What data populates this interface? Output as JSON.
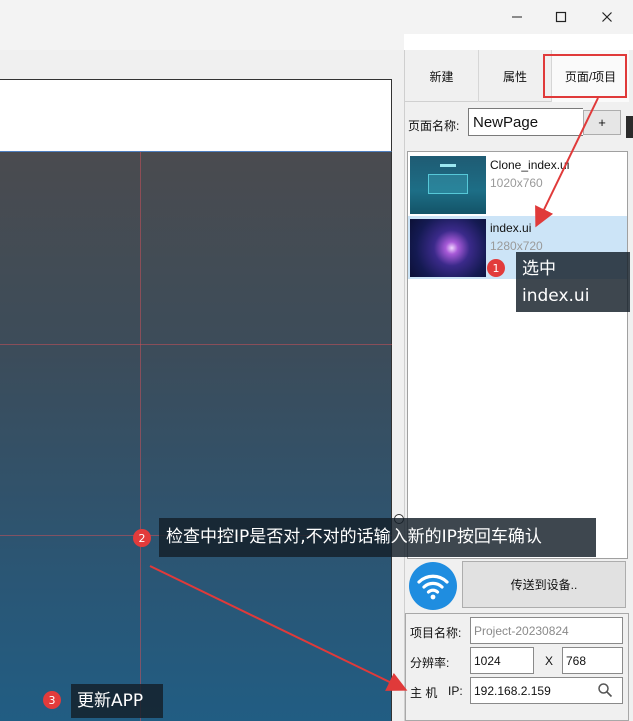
{
  "window": {
    "controls": {
      "minimize_icon": "minimize-icon",
      "maximize_icon": "maximize-icon",
      "close_icon": "close-icon"
    }
  },
  "panel": {
    "tabs": [
      {
        "label": "新建"
      },
      {
        "label": "属性"
      },
      {
        "label": "页面/项目"
      }
    ],
    "page_name": {
      "label": "页面名称:",
      "value": "NewPage",
      "add_label": "+"
    },
    "pages": [
      {
        "name": "Clone_index.ui",
        "size": "1020x760"
      },
      {
        "name": "index.ui",
        "size": "1280x720",
        "selected": true
      }
    ],
    "send_label": "传送到设备..",
    "project": {
      "name_label": "项目名称:",
      "name_placeholder": "Project-20230824",
      "resolution_label": "分辨率:",
      "width": "1024",
      "x_label": "X",
      "height": "768",
      "host_label": "主 机",
      "ip_label": "IP:",
      "ip_value": "192.168.2.159"
    }
  },
  "annotations": [
    {
      "num": "1",
      "line1": "选中",
      "line2": "index.ui"
    },
    {
      "num": "2",
      "text": "检查中控IP是否对,不对的话输入新的IP按回车确认"
    },
    {
      "num": "3",
      "text": "更新APP"
    }
  ],
  "colors": {
    "highlight_red": "#e03a3a",
    "selection_blue": "#cce4f7",
    "wifi_blue": "#1f8de0"
  }
}
